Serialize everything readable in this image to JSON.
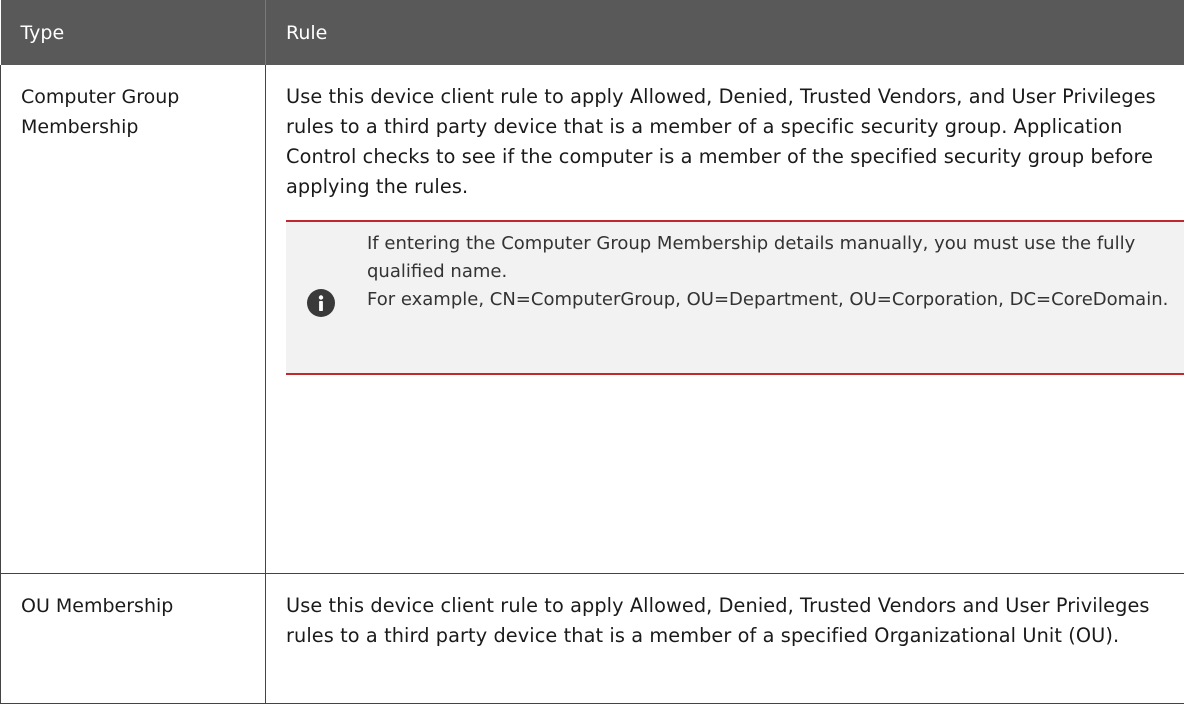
{
  "table": {
    "headers": [
      "Type",
      "Rule"
    ],
    "rows": [
      {
        "type": "Computer Group Membership",
        "rule": "Use this device client rule to apply Allowed, Denied, Trusted Vendors, and User Privileges rules to a third party device that is a member of a specific security group. Application Control checks to see if the computer is a member of the specified security group before applying the rules.",
        "note": {
          "icon": "info-icon",
          "line1": "If entering the Computer Group Membership details manually, you must use the fully qualified name.",
          "line2": "For example, CN=ComputerGroup, OU=Department, OU=Corporation, DC=CoreDomain."
        }
      },
      {
        "type": "OU Membership",
        "rule": "Use this device client rule to apply Allowed, Denied, Trusted Vendors and User Privileges rules to a third party device that is a member of a specified Organizational Unit (OU)."
      }
    ]
  },
  "colors": {
    "header_bg": "#595959",
    "note_border": "#c0282c",
    "note_bg": "#f2f2f2"
  }
}
